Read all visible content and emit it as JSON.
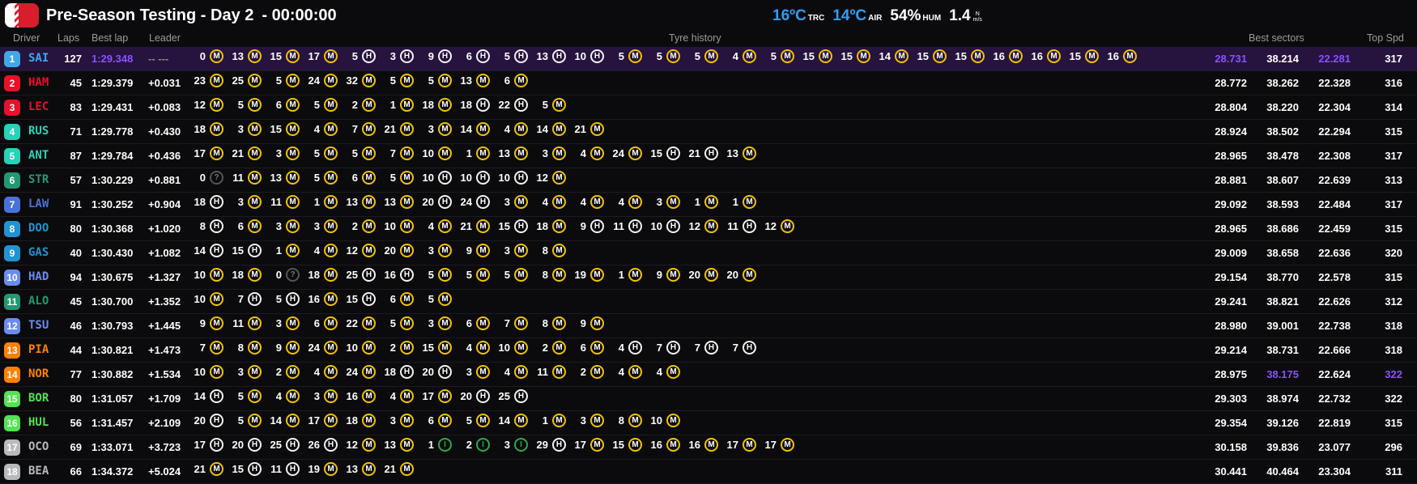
{
  "session": {
    "title": "Pre-Season Testing - Day 2",
    "clock": "- 00:00:00"
  },
  "weather": {
    "track_temp": "16ºC",
    "track_label": "TRC",
    "air_temp": "14ºC",
    "air_label": "AIR",
    "humidity": "54%",
    "humidity_label": "HUM",
    "wind": "1.4",
    "wind_unit_top": "N",
    "wind_unit_bottom": "m/s"
  },
  "columns": {
    "driver": "Driver",
    "laps": "Laps",
    "best_lap": "Best lap",
    "leader": "Leader",
    "tyre_history": "Tyre history",
    "best_sectors": "Best sectors",
    "top_speed": "Top Spd"
  },
  "colors": {
    "medium": "#f2c200",
    "hard": "#f2f2f2",
    "intermediate": "#2aa84a",
    "fastest": "#8a52ff"
  },
  "rows": [
    {
      "pos": "1",
      "code": "SAI",
      "color": "#3fa8e8",
      "laps": "127",
      "best": "1:29.348",
      "gap": "-- ---",
      "best_lap_fastest": true,
      "s1": "28.731",
      "s2": "38.214",
      "s3": "22.281",
      "spd": "317",
      "fast": [
        "s1",
        "s3"
      ],
      "stints": [
        [
          "0",
          "M"
        ],
        [
          "13",
          "M"
        ],
        [
          "15",
          "M"
        ],
        [
          "17",
          "M"
        ],
        [
          "5",
          "H"
        ],
        [
          "3",
          "H"
        ],
        [
          "9",
          "H"
        ],
        [
          "6",
          "H"
        ],
        [
          "5",
          "H"
        ],
        [
          "13",
          "H"
        ],
        [
          "10",
          "H"
        ],
        [
          "5",
          "M"
        ],
        [
          "5",
          "M"
        ],
        [
          "5",
          "M"
        ],
        [
          "4",
          "M"
        ],
        [
          "5",
          "M"
        ],
        [
          "15",
          "M"
        ],
        [
          "15",
          "M"
        ],
        [
          "14",
          "M"
        ],
        [
          "15",
          "M"
        ],
        [
          "15",
          "M"
        ],
        [
          "16",
          "M"
        ],
        [
          "16",
          "M"
        ],
        [
          "15",
          "M"
        ],
        [
          "16",
          "M"
        ]
      ]
    },
    {
      "pos": "2",
      "code": "HAM",
      "color": "#e8102a",
      "laps": "45",
      "best": "1:29.379",
      "gap": "+0.031",
      "s1": "28.772",
      "s2": "38.262",
      "s3": "22.328",
      "spd": "316",
      "stints": [
        [
          "23",
          "M"
        ],
        [
          "25",
          "M"
        ],
        [
          "5",
          "M"
        ],
        [
          "24",
          "M"
        ],
        [
          "32",
          "M"
        ],
        [
          "5",
          "M"
        ],
        [
          "5",
          "M"
        ],
        [
          "13",
          "M"
        ],
        [
          "6",
          "M"
        ]
      ]
    },
    {
      "pos": "3",
      "code": "LEC",
      "color": "#e8102a",
      "laps": "83",
      "best": "1:29.431",
      "gap": "+0.083",
      "s1": "28.804",
      "s2": "38.220",
      "s3": "22.304",
      "spd": "314",
      "stints": [
        [
          "12",
          "M"
        ],
        [
          "5",
          "M"
        ],
        [
          "6",
          "M"
        ],
        [
          "5",
          "M"
        ],
        [
          "2",
          "M"
        ],
        [
          "1",
          "M"
        ],
        [
          "18",
          "M"
        ],
        [
          "18",
          "H"
        ],
        [
          "22",
          "H"
        ],
        [
          "5",
          "M"
        ]
      ]
    },
    {
      "pos": "4",
      "code": "RUS",
      "color": "#27d2b8",
      "laps": "71",
      "best": "1:29.778",
      "gap": "+0.430",
      "s1": "28.924",
      "s2": "38.502",
      "s3": "22.294",
      "spd": "315",
      "stints": [
        [
          "18",
          "M"
        ],
        [
          "3",
          "M"
        ],
        [
          "15",
          "M"
        ],
        [
          "4",
          "M"
        ],
        [
          "7",
          "M"
        ],
        [
          "21",
          "M"
        ],
        [
          "3",
          "M"
        ],
        [
          "14",
          "M"
        ],
        [
          "4",
          "M"
        ],
        [
          "14",
          "M"
        ],
        [
          "21",
          "M"
        ]
      ]
    },
    {
      "pos": "5",
      "code": "ANT",
      "color": "#27d2b8",
      "laps": "87",
      "best": "1:29.784",
      "gap": "+0.436",
      "s1": "28.965",
      "s2": "38.478",
      "s3": "22.308",
      "spd": "317",
      "stints": [
        [
          "17",
          "M"
        ],
        [
          "21",
          "M"
        ],
        [
          "3",
          "M"
        ],
        [
          "5",
          "M"
        ],
        [
          "5",
          "M"
        ],
        [
          "7",
          "M"
        ],
        [
          "10",
          "M"
        ],
        [
          "1",
          "M"
        ],
        [
          "13",
          "M"
        ],
        [
          "3",
          "M"
        ],
        [
          "4",
          "M"
        ],
        [
          "24",
          "M"
        ],
        [
          "15",
          "H"
        ],
        [
          "21",
          "H"
        ],
        [
          "13",
          "M"
        ]
      ]
    },
    {
      "pos": "6",
      "code": "STR",
      "color": "#229971",
      "laps": "57",
      "best": "1:30.229",
      "gap": "+0.881",
      "s1": "28.881",
      "s2": "38.607",
      "s3": "22.639",
      "spd": "313",
      "stints": [
        [
          "0",
          "?"
        ],
        [
          "11",
          "M"
        ],
        [
          "13",
          "M"
        ],
        [
          "5",
          "M"
        ],
        [
          "6",
          "M"
        ],
        [
          "5",
          "M"
        ],
        [
          "10",
          "H"
        ],
        [
          "10",
          "H"
        ],
        [
          "10",
          "H"
        ],
        [
          "12",
          "M"
        ]
      ]
    },
    {
      "pos": "7",
      "code": "LAW",
      "color": "#4a72d6",
      "laps": "91",
      "best": "1:30.252",
      "gap": "+0.904",
      "s1": "29.092",
      "s2": "38.593",
      "s3": "22.484",
      "spd": "317",
      "stints": [
        [
          "18",
          "H"
        ],
        [
          "3",
          "M"
        ],
        [
          "11",
          "M"
        ],
        [
          "1",
          "M"
        ],
        [
          "13",
          "M"
        ],
        [
          "13",
          "M"
        ],
        [
          "20",
          "H"
        ],
        [
          "24",
          "H"
        ],
        [
          "3",
          "M"
        ],
        [
          "4",
          "M"
        ],
        [
          "4",
          "M"
        ],
        [
          "4",
          "M"
        ],
        [
          "3",
          "M"
        ],
        [
          "1",
          "M"
        ],
        [
          "1",
          "M"
        ]
      ]
    },
    {
      "pos": "8",
      "code": "DOO",
      "color": "#2293d1",
      "laps": "80",
      "best": "1:30.368",
      "gap": "+1.020",
      "s1": "28.965",
      "s2": "38.686",
      "s3": "22.459",
      "spd": "315",
      "stints": [
        [
          "8",
          "H"
        ],
        [
          "6",
          "M"
        ],
        [
          "3",
          "M"
        ],
        [
          "3",
          "M"
        ],
        [
          "2",
          "M"
        ],
        [
          "10",
          "M"
        ],
        [
          "4",
          "M"
        ],
        [
          "21",
          "M"
        ],
        [
          "15",
          "H"
        ],
        [
          "18",
          "M"
        ],
        [
          "9",
          "H"
        ],
        [
          "11",
          "H"
        ],
        [
          "10",
          "H"
        ],
        [
          "12",
          "M"
        ],
        [
          "11",
          "H"
        ],
        [
          "12",
          "M"
        ]
      ]
    },
    {
      "pos": "9",
      "code": "GAS",
      "color": "#2293d1",
      "laps": "40",
      "best": "1:30.430",
      "gap": "+1.082",
      "s1": "29.009",
      "s2": "38.658",
      "s3": "22.636",
      "spd": "320",
      "stints": [
        [
          "14",
          "H"
        ],
        [
          "15",
          "H"
        ],
        [
          "1",
          "M"
        ],
        [
          "4",
          "M"
        ],
        [
          "12",
          "M"
        ],
        [
          "20",
          "M"
        ],
        [
          "3",
          "M"
        ],
        [
          "9",
          "M"
        ],
        [
          "3",
          "M"
        ],
        [
          "8",
          "M"
        ]
      ]
    },
    {
      "pos": "10",
      "code": "HAD",
      "color": "#6a8cf0",
      "laps": "94",
      "best": "1:30.675",
      "gap": "+1.327",
      "s1": "29.154",
      "s2": "38.770",
      "s3": "22.578",
      "spd": "315",
      "stints": [
        [
          "10",
          "M"
        ],
        [
          "18",
          "M"
        ],
        [
          "0",
          "?"
        ],
        [
          "18",
          "M"
        ],
        [
          "25",
          "H"
        ],
        [
          "16",
          "H"
        ],
        [
          "5",
          "M"
        ],
        [
          "5",
          "M"
        ],
        [
          "5",
          "M"
        ],
        [
          "8",
          "M"
        ],
        [
          "19",
          "M"
        ],
        [
          "1",
          "M"
        ],
        [
          "9",
          "M"
        ],
        [
          "20",
          "M"
        ],
        [
          "20",
          "M"
        ]
      ]
    },
    {
      "pos": "11",
      "code": "ALO",
      "color": "#229971",
      "laps": "45",
      "best": "1:30.700",
      "gap": "+1.352",
      "s1": "29.241",
      "s2": "38.821",
      "s3": "22.626",
      "spd": "312",
      "stints": [
        [
          "10",
          "M"
        ],
        [
          "7",
          "H"
        ],
        [
          "5",
          "H"
        ],
        [
          "16",
          "M"
        ],
        [
          "15",
          "H"
        ],
        [
          "6",
          "M"
        ],
        [
          "5",
          "M"
        ]
      ]
    },
    {
      "pos": "12",
      "code": "TSU",
      "color": "#6a8cf0",
      "laps": "46",
      "best": "1:30.793",
      "gap": "+1.445",
      "s1": "28.980",
      "s2": "39.001",
      "s3": "22.738",
      "spd": "318",
      "stints": [
        [
          "9",
          "M"
        ],
        [
          "11",
          "M"
        ],
        [
          "3",
          "M"
        ],
        [
          "6",
          "M"
        ],
        [
          "22",
          "M"
        ],
        [
          "5",
          "M"
        ],
        [
          "3",
          "M"
        ],
        [
          "6",
          "M"
        ],
        [
          "7",
          "M"
        ],
        [
          "8",
          "M"
        ],
        [
          "9",
          "M"
        ]
      ]
    },
    {
      "pos": "13",
      "code": "PIA",
      "color": "#ff8000",
      "laps": "44",
      "best": "1:30.821",
      "gap": "+1.473",
      "s1": "29.214",
      "s2": "38.731",
      "s3": "22.666",
      "spd": "318",
      "stints": [
        [
          "7",
          "M"
        ],
        [
          "8",
          "M"
        ],
        [
          "9",
          "M"
        ],
        [
          "24",
          "M"
        ],
        [
          "10",
          "M"
        ],
        [
          "2",
          "M"
        ],
        [
          "15",
          "M"
        ],
        [
          "4",
          "M"
        ],
        [
          "10",
          "M"
        ],
        [
          "2",
          "M"
        ],
        [
          "6",
          "M"
        ],
        [
          "4",
          "H"
        ],
        [
          "7",
          "H"
        ],
        [
          "7",
          "H"
        ],
        [
          "7",
          "H"
        ]
      ]
    },
    {
      "pos": "14",
      "code": "NOR",
      "color": "#ff8000",
      "laps": "77",
      "best": "1:30.882",
      "gap": "+1.534",
      "s1": "28.975",
      "s2": "38.175",
      "s3": "22.624",
      "spd": "322",
      "fast": [
        "s2",
        "spd"
      ],
      "stints": [
        [
          "10",
          "M"
        ],
        [
          "3",
          "M"
        ],
        [
          "2",
          "M"
        ],
        [
          "4",
          "M"
        ],
        [
          "24",
          "M"
        ],
        [
          "18",
          "H"
        ],
        [
          "20",
          "H"
        ],
        [
          "3",
          "M"
        ],
        [
          "4",
          "M"
        ],
        [
          "11",
          "M"
        ],
        [
          "2",
          "M"
        ],
        [
          "4",
          "M"
        ],
        [
          "4",
          "M"
        ]
      ]
    },
    {
      "pos": "15",
      "code": "BOR",
      "color": "#52e252",
      "laps": "80",
      "best": "1:31.057",
      "gap": "+1.709",
      "s1": "29.303",
      "s2": "38.974",
      "s3": "22.732",
      "spd": "322",
      "stints": [
        [
          "14",
          "H"
        ],
        [
          "5",
          "M"
        ],
        [
          "4",
          "M"
        ],
        [
          "3",
          "M"
        ],
        [
          "16",
          "M"
        ],
        [
          "4",
          "M"
        ],
        [
          "17",
          "M"
        ],
        [
          "20",
          "H"
        ],
        [
          "25",
          "H"
        ]
      ]
    },
    {
      "pos": "16",
      "code": "HUL",
      "color": "#52e252",
      "laps": "56",
      "best": "1:31.457",
      "gap": "+2.109",
      "s1": "29.354",
      "s2": "39.126",
      "s3": "22.819",
      "spd": "315",
      "stints": [
        [
          "20",
          "H"
        ],
        [
          "5",
          "M"
        ],
        [
          "14",
          "M"
        ],
        [
          "17",
          "M"
        ],
        [
          "18",
          "M"
        ],
        [
          "3",
          "M"
        ],
        [
          "6",
          "M"
        ],
        [
          "5",
          "M"
        ],
        [
          "14",
          "M"
        ],
        [
          "1",
          "M"
        ],
        [
          "3",
          "M"
        ],
        [
          "8",
          "M"
        ],
        [
          "10",
          "M"
        ]
      ]
    },
    {
      "pos": "17",
      "code": "OCO",
      "color": "#b6babd",
      "laps": "69",
      "best": "1:33.071",
      "gap": "+3.723",
      "s1": "30.158",
      "s2": "39.836",
      "s3": "23.077",
      "spd": "296",
      "stints": [
        [
          "17",
          "H"
        ],
        [
          "20",
          "H"
        ],
        [
          "25",
          "H"
        ],
        [
          "26",
          "H"
        ],
        [
          "12",
          "M"
        ],
        [
          "13",
          "M"
        ],
        [
          "1",
          "I"
        ],
        [
          "2",
          "I"
        ],
        [
          "3",
          "I"
        ],
        [
          "29",
          "H"
        ],
        [
          "17",
          "M"
        ],
        [
          "15",
          "M"
        ],
        [
          "16",
          "M"
        ],
        [
          "16",
          "M"
        ],
        [
          "17",
          "M"
        ],
        [
          "17",
          "M"
        ]
      ]
    },
    {
      "pos": "18",
      "code": "BEA",
      "color": "#b6babd",
      "laps": "66",
      "best": "1:34.372",
      "gap": "+5.024",
      "s1": "30.441",
      "s2": "40.464",
      "s3": "23.304",
      "spd": "311",
      "stints": [
        [
          "21",
          "M"
        ],
        [
          "15",
          "H"
        ],
        [
          "11",
          "H"
        ],
        [
          "19",
          "M"
        ],
        [
          "13",
          "M"
        ],
        [
          "21",
          "M"
        ]
      ]
    }
  ]
}
